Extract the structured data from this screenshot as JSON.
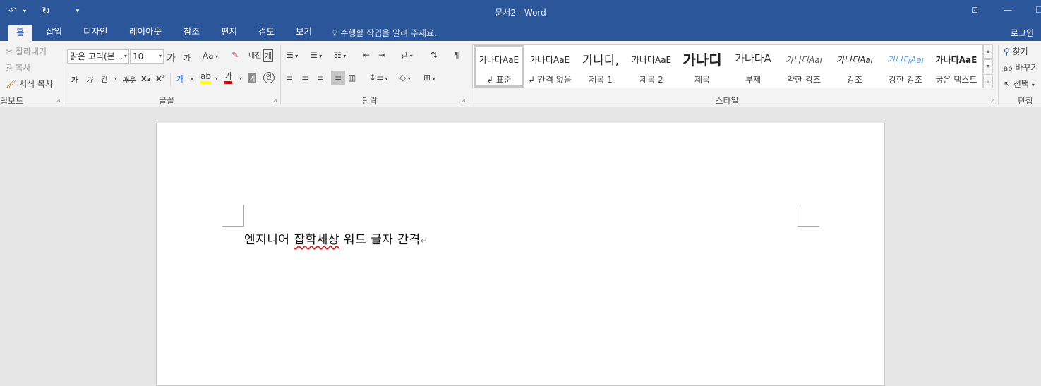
{
  "titlebar": {
    "title": "문서2 - Word",
    "undo_icon": "undo-icon",
    "redo_icon": "redo-icon",
    "qat_icon": "customize-qat-icon",
    "minimize": "—"
  },
  "tabs": [
    "홈",
    "삽입",
    "디자인",
    "레이아웃",
    "참조",
    "편지",
    "검토",
    "보기"
  ],
  "tell_me": "수행할 작업을 알려 주세요.",
  "login": "로그인",
  "clipboard": {
    "cut": "잘라내기",
    "copy": "복사",
    "format_painter": "서식 복사",
    "label": "립보드"
  },
  "font": {
    "name": "맑은 고딕(본…",
    "size": "10",
    "grow": "가",
    "shrink": "가",
    "case": "Aa",
    "bold": "가",
    "italic": "가",
    "underline": "간",
    "strike": "개웃",
    "subscript": "x₂",
    "superscript": "x²",
    "label": "글꼴"
  },
  "paragraph": {
    "label": "단락"
  },
  "styles": {
    "label": "스타일",
    "items": [
      {
        "preview": "가나다AaE",
        "name": "↲ 표준"
      },
      {
        "preview": "가나다AaE",
        "name": "↲ 간격 없음"
      },
      {
        "preview": "가나다,",
        "name": "제목 1"
      },
      {
        "preview": "가나다AaE",
        "name": "제목 2"
      },
      {
        "preview": "가나디",
        "name": "제목"
      },
      {
        "preview": "가나다A",
        "name": "부제"
      },
      {
        "preview": "가나다Aaı",
        "name": "약한 강조"
      },
      {
        "preview": "가나다Aaı",
        "name": "강조"
      },
      {
        "preview": "가나다Aaı",
        "name": "강한 강조"
      },
      {
        "preview": "가나다AaE",
        "name": "굵은 텍스트"
      }
    ]
  },
  "editing": {
    "find": "찾기",
    "replace": "바꾸기",
    "select": "선택",
    "label": "편집"
  },
  "document": {
    "text_plain_1": "엔지니어 ",
    "text_misspelled": "잡학세상",
    "text_plain_2": " 워드 글자 간격",
    "para_mark": "↵"
  },
  "colors": {
    "accent": "#2b579a",
    "highlight": "#ffff00",
    "font_color": "#e00000"
  }
}
